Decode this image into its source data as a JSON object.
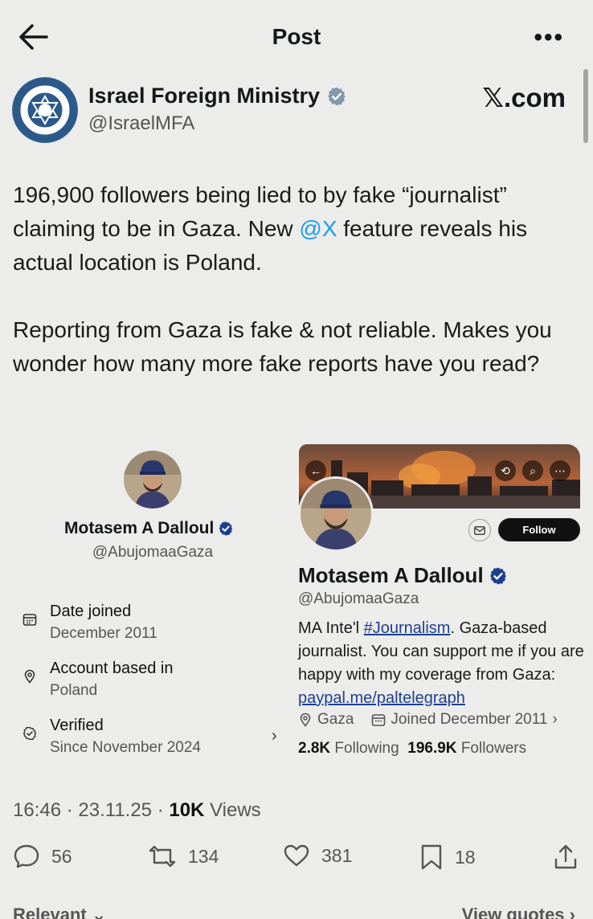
{
  "header": {
    "title": "Post",
    "more_label": "•••"
  },
  "author": {
    "name": "Israel Foreign Ministry",
    "handle": "@IsraelMFA",
    "source": "𝕏.com"
  },
  "tweet": {
    "line1_pre": "196,900 followers being lied to by fake “journalist” claiming to be in Gaza. New ",
    "mention": "@X",
    "line1_post": " feature reveals his actual location is Poland.",
    "line2": "Reporting from Gaza is fake & not reliable. Makes you wonder how many more fake reports have you read?"
  },
  "embed_about": {
    "name": "Motasem A Dalloul",
    "handle": "@AbujomaaGaza",
    "rows": [
      {
        "label": "Date joined",
        "value": "December 2011",
        "icon": "calendar-icon"
      },
      {
        "label": "Account based in",
        "value": "Poland",
        "icon": "location-pin-icon"
      },
      {
        "label": "Verified",
        "value": "Since November 2024",
        "icon": "verified-check-icon"
      }
    ],
    "chevron": "›"
  },
  "embed_profile": {
    "follow_label": "Follow",
    "name": "Motasem A Dalloul",
    "handle": "@AbujomaaGaza",
    "bio_pre": "MA Inte'l ",
    "bio_hashtag": "#Journalism",
    "bio_mid": ". Gaza-based journalist. You can support me if you are happy with my coverage from Gaza: ",
    "bio_link": "paypal.me/paltelegraph",
    "location": "Gaza",
    "joined": "Joined December 2011",
    "following_count": "2.8K",
    "following_label": "Following",
    "followers_count": "196.9K",
    "followers_label": "Followers"
  },
  "meta": {
    "time": "16:46",
    "date": "23.11.25",
    "views_count": "10K",
    "views_label": "Views"
  },
  "actions": {
    "replies": "56",
    "reposts": "134",
    "likes": "381",
    "bookmarks": "18"
  },
  "footer": {
    "relevant_label": "Relevant",
    "view_quotes_label": "View quotes"
  },
  "colors": {
    "background": "#ececeb",
    "mention": "#1d9bf0",
    "verified_gray": "#829aab",
    "verified_blue": "#1d3f8f",
    "mfa_logo": "#2b5a8a"
  }
}
